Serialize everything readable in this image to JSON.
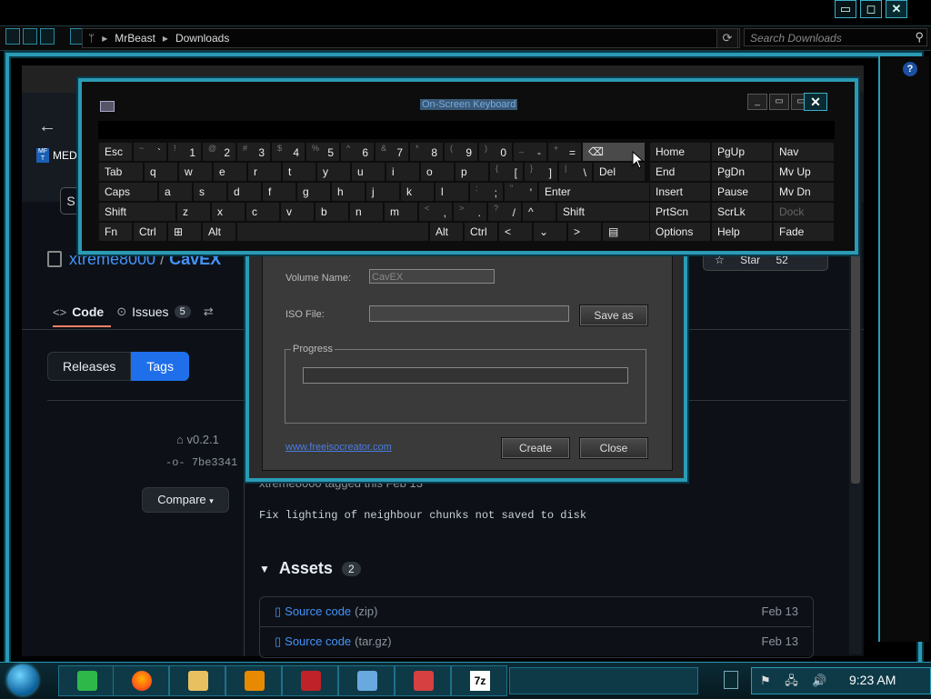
{
  "explorer": {
    "path": [
      "MrBeast",
      "Downloads"
    ],
    "search_placeholder": "Search Downloads",
    "nav_glyph": "ᛘ",
    "sep": "▸",
    "chevron": "⌄",
    "refresh": "⟳",
    "window_controls": [
      "▭",
      "◻",
      "✕"
    ]
  },
  "browser": {
    "med_label": "MED",
    "med_logo": "MF T",
    "s_button": "S",
    "repo_owner": "xtreme8000",
    "repo_sep": " / ",
    "repo_name": "CavEX",
    "star_label": "Star",
    "star_count": "52",
    "tabs": [
      {
        "label": "Code",
        "icon": "<>"
      },
      {
        "label": "Issues",
        "icon": "⊙",
        "count": "5"
      },
      {
        "label": "",
        "icon": "⇄"
      }
    ],
    "segment": {
      "releases": "Releases",
      "tags": "Tags"
    },
    "tag_version": "v0.2.1",
    "tag_commit": "7be3341",
    "compare_label": "Compare",
    "tagged_line": "xtreme8000 tagged this Feb 13",
    "commit_message": "Fix lighting of neighbour chunks not saved to disk",
    "assets_title": "Assets",
    "assets_count": "2",
    "assets": [
      {
        "name": "Source code",
        "meta": "(zip)",
        "date": "Feb 13"
      },
      {
        "name": "Source code",
        "meta": "(tar.gz)",
        "date": "Feb 13"
      }
    ]
  },
  "dialog": {
    "volume_label": "Volume Name:",
    "volume_value": "CavEX",
    "iso_label": "ISO File:",
    "iso_value": "",
    "save_as": "Save as",
    "progress_label": "Progress",
    "progress_value": 0,
    "link": "www.freeisocreator.com",
    "create": "Create",
    "close": "Close"
  },
  "osk": {
    "title": "On-Screen Keyboard",
    "close_glyph": "✕",
    "rows": [
      [
        [
          "Esc",
          ""
        ],
        [
          "`",
          "~"
        ],
        [
          "1",
          "!"
        ],
        [
          "2",
          "@"
        ],
        [
          "3",
          "#"
        ],
        [
          "4",
          "$"
        ],
        [
          "5",
          "%"
        ],
        [
          "6",
          "^"
        ],
        [
          "7",
          "&"
        ],
        [
          "8",
          "*"
        ],
        [
          "9",
          "("
        ],
        [
          "0",
          ")"
        ],
        [
          "-",
          "_"
        ],
        [
          "=",
          "+"
        ],
        [
          "⌫",
          ""
        ]
      ],
      [
        [
          "Tab",
          ""
        ],
        [
          "q",
          ""
        ],
        [
          "w",
          ""
        ],
        [
          "e",
          ""
        ],
        [
          "r",
          ""
        ],
        [
          "t",
          ""
        ],
        [
          "y",
          ""
        ],
        [
          "u",
          ""
        ],
        [
          "i",
          ""
        ],
        [
          "o",
          ""
        ],
        [
          "p",
          ""
        ],
        [
          "[",
          "{"
        ],
        [
          "]",
          "}"
        ],
        [
          "\\",
          "|"
        ],
        [
          "Del",
          ""
        ]
      ],
      [
        [
          "Caps",
          ""
        ],
        [
          "a",
          ""
        ],
        [
          "s",
          ""
        ],
        [
          "d",
          ""
        ],
        [
          "f",
          ""
        ],
        [
          "g",
          ""
        ],
        [
          "h",
          ""
        ],
        [
          "j",
          ""
        ],
        [
          "k",
          ""
        ],
        [
          "l",
          ""
        ],
        [
          ";",
          ":"
        ],
        [
          "'",
          "\""
        ],
        [
          "Enter",
          ""
        ]
      ],
      [
        [
          "Shift",
          ""
        ],
        [
          "z",
          ""
        ],
        [
          "x",
          ""
        ],
        [
          "c",
          ""
        ],
        [
          "v",
          ""
        ],
        [
          "b",
          ""
        ],
        [
          "n",
          ""
        ],
        [
          "m",
          ""
        ],
        [
          ",",
          "<"
        ],
        [
          ".",
          ">"
        ],
        [
          "/",
          "?"
        ],
        [
          "^",
          ""
        ],
        [
          "Shift",
          ""
        ]
      ],
      [
        [
          "Fn",
          ""
        ],
        [
          "Ctrl",
          ""
        ],
        [
          "⊞",
          ""
        ],
        [
          "Alt",
          ""
        ],
        [
          "",
          ""
        ],
        [
          "Alt",
          ""
        ],
        [
          "Ctrl",
          ""
        ],
        [
          "<",
          ""
        ],
        [
          "⌄",
          ""
        ],
        [
          ">",
          ""
        ],
        [
          "▤",
          ""
        ]
      ]
    ],
    "right_keys": [
      [
        "Home",
        "PgUp",
        "Nav"
      ],
      [
        "End",
        "PgDn",
        "Mv Up"
      ],
      [
        "Insert",
        "Pause",
        "Mv Dn"
      ],
      [
        "PrtScn",
        "ScrLk",
        "Dock"
      ],
      [
        "Options",
        "Help",
        "Fade"
      ]
    ]
  },
  "taskbar": {
    "apps": [
      "notes-app",
      "firefox",
      "file-explorer",
      "search-app",
      "game-app",
      "keyboard-app",
      "office-app",
      "7zip"
    ],
    "seven_zip_label": "7z",
    "clock": "9:23 AM",
    "tray": "⚑ 🖧 🔊"
  },
  "colors": {
    "frame": "#2a9ab5",
    "github_bg": "#0d1117",
    "link": "#4493f8",
    "tags_active": "#1f6feb"
  }
}
